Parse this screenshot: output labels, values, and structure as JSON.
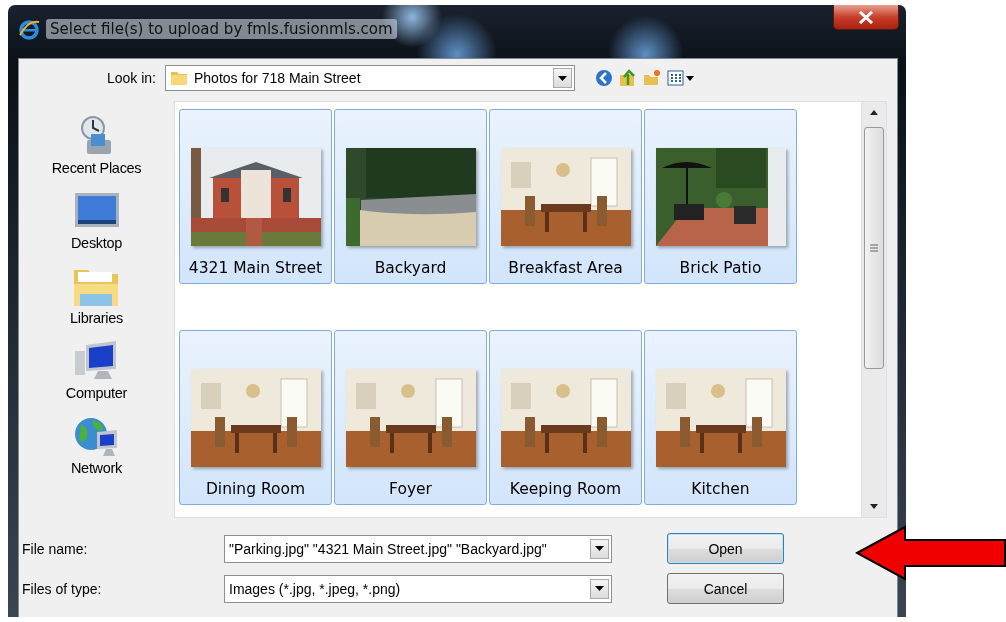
{
  "window": {
    "title": "Select file(s) to upload by fmls.fusionmls.com"
  },
  "look_in": {
    "label": "Look in:",
    "value": "Photos for 718 Main Street"
  },
  "sidebar": {
    "items": [
      {
        "label": "Recent Places",
        "kind": "recent"
      },
      {
        "label": "Desktop",
        "kind": "desktop"
      },
      {
        "label": "Libraries",
        "kind": "libraries"
      },
      {
        "label": "Computer",
        "kind": "computer"
      },
      {
        "label": "Network",
        "kind": "network"
      }
    ]
  },
  "files": [
    {
      "name": "4321 Main Street",
      "selected": true
    },
    {
      "name": "Backyard",
      "selected": true
    },
    {
      "name": "Breakfast Area",
      "selected": true
    },
    {
      "name": "Brick Patio",
      "selected": true
    },
    {
      "name": "Dining Room",
      "selected": true
    },
    {
      "name": "Foyer",
      "selected": true
    },
    {
      "name": "Keeping Room",
      "selected": true
    },
    {
      "name": "Kitchen",
      "selected": true
    }
  ],
  "file_name": {
    "label": "File name:",
    "value": "\"Parking.jpg\" \"4321 Main Street.jpg\" \"Backyard.jpg\""
  },
  "file_type": {
    "label": "Files of type:",
    "value": "Images (*.jpg, *.jpeg, *.png)"
  },
  "buttons": [
    "Open",
    "Cancel"
  ]
}
